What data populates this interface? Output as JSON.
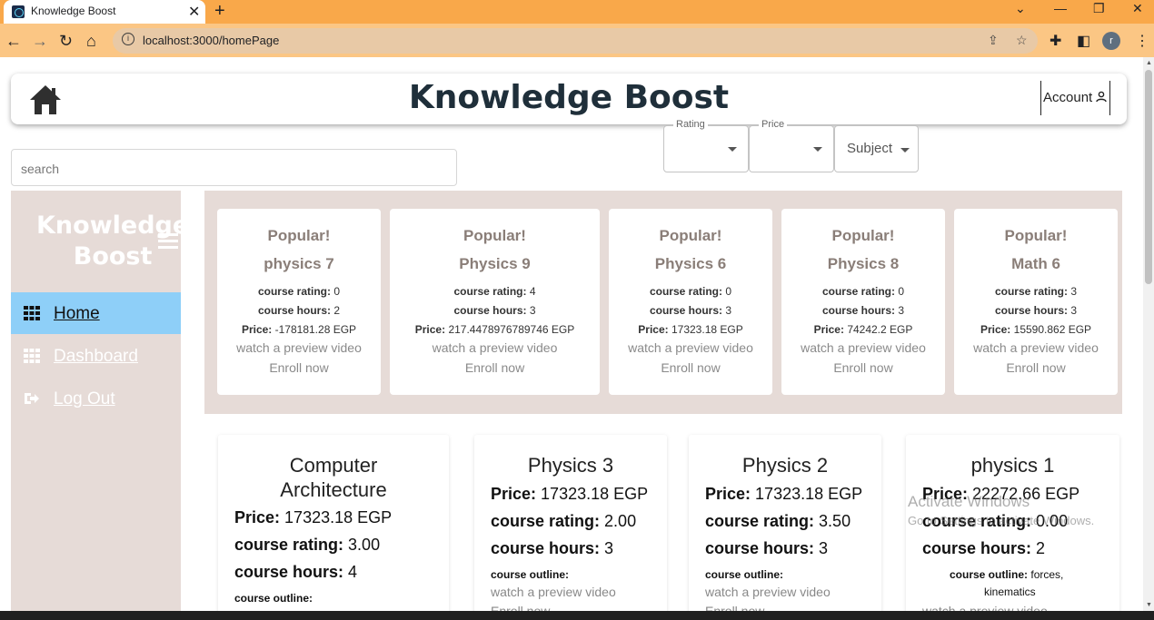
{
  "browser": {
    "tab_title": "Knowledge Boost",
    "url": "localhost:3000/homePage",
    "profile_initial": "r"
  },
  "header": {
    "title": "Knowledge Boost",
    "account_label": "Account"
  },
  "search": {
    "placeholder": "search"
  },
  "filters": {
    "rating_label": "Rating",
    "price_label": "Price",
    "subject_label": "Subject"
  },
  "sidebar": {
    "brand_line1": "Knowledge",
    "brand_line2": "Boost",
    "items": [
      {
        "label": "Home",
        "icon": "grid-icon",
        "active": true
      },
      {
        "label": "Dashboard",
        "icon": "grid-icon",
        "active": false
      },
      {
        "label": "Log Out",
        "icon": "logout-icon",
        "active": false
      }
    ]
  },
  "popular_courses": [
    {
      "tag": "Popular!",
      "name": "physics 7",
      "rating": "0",
      "hours": "2",
      "price": "-178181.28 EGP",
      "preview": "watch a preview video",
      "enroll": "Enroll now"
    },
    {
      "tag": "Popular!",
      "name": "Physics 9",
      "rating": "4",
      "hours": "3",
      "price": "217.4478976789746 EGP",
      "preview": "watch a preview video",
      "enroll": "Enroll now"
    },
    {
      "tag": "Popular!",
      "name": "Physics 6",
      "rating": "0",
      "hours": "3",
      "price": "17323.18 EGP",
      "preview": "watch a preview video",
      "enroll": "Enroll now"
    },
    {
      "tag": "Popular!",
      "name": "Physics 8",
      "rating": "0",
      "hours": "3",
      "price": "74242.2 EGP",
      "preview": "watch a preview video",
      "enroll": "Enroll now"
    },
    {
      "tag": "Popular!",
      "name": "Math 6",
      "rating": "3",
      "hours": "3",
      "price": "15590.862 EGP",
      "preview": "watch a preview video",
      "enroll": "Enroll now"
    }
  ],
  "labels": {
    "course_rating": "course rating:",
    "course_hours": "course hours:",
    "price": "Price:",
    "course_outline": "course outline:"
  },
  "courses": [
    {
      "title_line1": "Computer",
      "title_line2": "Architecture",
      "price": "17323.18 EGP",
      "rating": "3.00",
      "hours": "4",
      "outline": "",
      "preview": "",
      "enroll": ""
    },
    {
      "title_line1": "Physics 3",
      "price": "17323.18 EGP",
      "rating": "2.00",
      "hours": "3",
      "outline": "",
      "preview": "watch a preview video",
      "enroll": "Enroll now"
    },
    {
      "title_line1": "Physics 2",
      "price": "17323.18 EGP",
      "rating": "3.50",
      "hours": "3",
      "outline": "",
      "preview": "watch a preview video",
      "enroll": "Enroll now"
    },
    {
      "title_line1": "physics 1",
      "price": "22272.66 EGP",
      "rating": "0.00",
      "hours": "2",
      "outline": "forces,",
      "outline_line2": "kinematics",
      "preview": "watch a preview video"
    }
  ],
  "watermark": {
    "line1": "Activate Windows",
    "line2": "Go to Settings to activate Windows."
  }
}
